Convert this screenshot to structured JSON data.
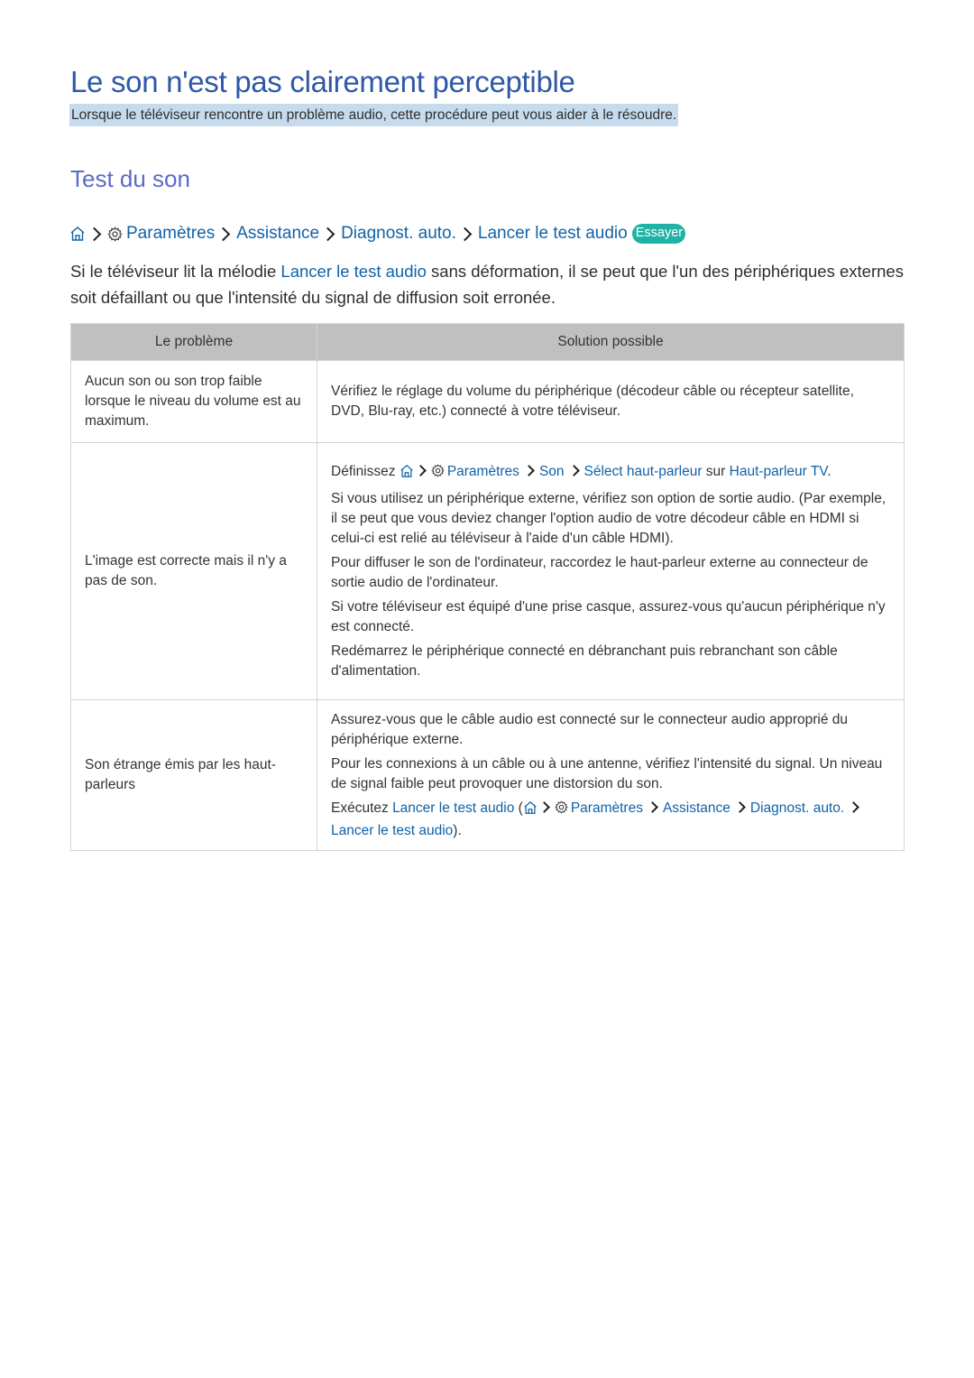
{
  "page": {
    "title": "Le son n'est pas clairement perceptible",
    "intro": "Lorsque le téléviseur rencontre un problème audio, cette procédure peut vous aider à le résoudre."
  },
  "section": {
    "title": "Test du son",
    "breadcrumb": {
      "icons": [
        "home-icon",
        "gear-icon"
      ],
      "items": [
        "Paramètres",
        "Assistance",
        "Diagnost. auto.",
        "Lancer le test audio"
      ],
      "try_label": "Essayer"
    },
    "body": {
      "before": "Si le téléviseur lit la mélodie ",
      "link": "Lancer le test audio",
      "after": " sans déformation, il se peut que l'un des périphériques externes soit défaillant ou que l'intensité du signal de diffusion soit erronée."
    }
  },
  "table": {
    "headers": [
      "Le problème",
      "Solution possible"
    ],
    "rows": [
      {
        "problem": "Aucun son ou son trop faible lorsque le niveau du volume est au maximum.",
        "solutions": {
          "s1": "Vérifiez le réglage du volume du périphérique (décodeur câble ou récepteur satellite, DVD, Blu-ray, etc.) connecté à votre téléviseur."
        }
      },
      {
        "problem": "L'image est correcte mais il n'y a pas de son.",
        "solutions": {
          "set_prefix": "Définissez ",
          "set_path": [
            "Paramètres",
            "Son",
            "Sélect haut-parleur"
          ],
          "set_on": " sur ",
          "set_value": "Haut-parleur TV",
          "set_end": ".",
          "s2": "Si vous utilisez un périphérique externe, vérifiez son option de sortie audio. (Par exemple, il se peut que vous deviez changer l'option audio de votre décodeur câble en HDMI si celui-ci est relié au téléviseur à l'aide d'un câble HDMI).",
          "s3": "Pour diffuser le son de l'ordinateur, raccordez le haut-parleur externe au connecteur de sortie audio de l'ordinateur.",
          "s4": "Si votre téléviseur est équipé d'une prise casque, assurez-vous qu'aucun périphérique n'y est connecté.",
          "s5": "Redémarrez le périphérique connecté en débranchant puis rebranchant son câble d'alimentation."
        }
      },
      {
        "problem": "Son étrange émis par les haut-parleurs",
        "solutions": {
          "s1": "Assurez-vous que le câble audio est connecté sur le connecteur audio approprié du périphérique externe.",
          "s2": "Pour les connexions à un câble ou à une antenne, vérifiez l'intensité du signal. Un niveau de signal faible peut provoquer une distorsion du son.",
          "run_prefix": "Exécutez ",
          "run_link": "Lancer le test audio",
          "run_open": " (",
          "run_path": [
            "Paramètres",
            "Assistance",
            "Diagnost. auto.",
            "Lancer le test audio"
          ],
          "run_close": ")."
        }
      }
    ]
  },
  "colors": {
    "title": "#2f58a6",
    "section_title": "#5b6bc8",
    "link": "#1062a8",
    "intro_highlight": "#c7dbee",
    "try_badge": "#1fb2a5",
    "table_header": "#c0c0c0"
  }
}
